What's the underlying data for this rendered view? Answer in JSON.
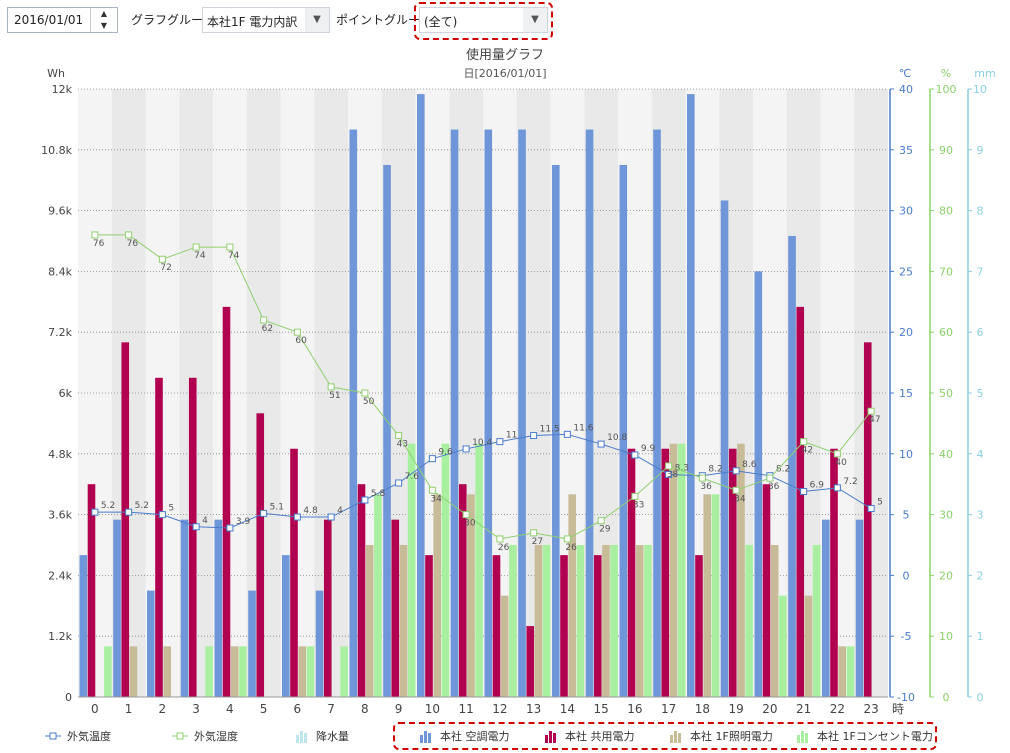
{
  "toolbar": {
    "date_value": "2016/01/01",
    "graph_group_label": "グラフグループ:",
    "graph_group_value": "本社1F 電力内訳",
    "point_group_label": "ポイントグループ:",
    "point_group_value": "(全て)"
  },
  "chart_data": {
    "type": "bar",
    "title": "使用量グラフ",
    "subtitle": "日[2016/01/01]",
    "categories": [
      "0",
      "1",
      "2",
      "3",
      "4",
      "5",
      "6",
      "7",
      "8",
      "9",
      "10",
      "11",
      "12",
      "13",
      "14",
      "15",
      "16",
      "17",
      "18",
      "19",
      "20",
      "21",
      "22",
      "23"
    ],
    "x_unit": "時",
    "y_left": {
      "unit": "Wh",
      "ticks": [
        "0",
        "1.2k",
        "2.4k",
        "3.6k",
        "4.8k",
        "6k",
        "7.2k",
        "8.4k",
        "9.6k",
        "10.8k",
        "12k"
      ],
      "ylim": [
        0,
        12000
      ]
    },
    "y_temp": {
      "unit": "℃",
      "ticks": [
        "-10",
        "-5",
        "0",
        "5",
        "10",
        "15",
        "20",
        "25",
        "30",
        "35",
        "40"
      ],
      "ylim": [
        -10,
        40
      ]
    },
    "y_humidity": {
      "unit": "%",
      "ticks": [
        "0",
        "10",
        "20",
        "30",
        "40",
        "50",
        "60",
        "70",
        "80",
        "90",
        "100"
      ],
      "ylim": [
        0,
        100
      ]
    },
    "y_rain": {
      "unit": "mm",
      "ticks": [
        "0",
        "1",
        "2",
        "3",
        "4",
        "5",
        "6",
        "7",
        "8",
        "9",
        "10"
      ],
      "ylim": [
        0,
        10
      ]
    },
    "bar_series": [
      {
        "name": "本社 空調電力",
        "color": "#6f96d8",
        "values": [
          2800,
          3500,
          2100,
          3500,
          3500,
          2100,
          2800,
          2100,
          11200,
          10500,
          11900,
          11200,
          11200,
          11200,
          10500,
          11200,
          10500,
          11200,
          11900,
          9800,
          8400,
          9100,
          3500,
          3500
        ]
      },
      {
        "name": "本社 共用電力",
        "color": "#b0004f",
        "values": [
          4200,
          7000,
          6300,
          6300,
          7700,
          5600,
          4900,
          3500,
          4200,
          3500,
          2800,
          4200,
          2800,
          1400,
          2800,
          2800,
          4900,
          4900,
          2800,
          4900,
          4200,
          7700,
          4900,
          7000
        ]
      },
      {
        "name": "本社 1F照明電力",
        "color": "#c8bb98",
        "values": [
          0,
          1000,
          1000,
          0,
          1000,
          0,
          1000,
          0,
          3000,
          3000,
          4000,
          4000,
          2000,
          3000,
          4000,
          3000,
          3000,
          5000,
          4000,
          5000,
          3000,
          2000,
          1000,
          0
        ]
      },
      {
        "name": "本社 1Fコンセント電力",
        "color": "#a8f0a0",
        "values": [
          1000,
          0,
          0,
          1000,
          1000,
          0,
          1000,
          1000,
          4000,
          5000,
          5000,
          5000,
          3000,
          3000,
          3000,
          3000,
          3000,
          5000,
          4000,
          3000,
          2000,
          3000,
          1000,
          0
        ]
      }
    ],
    "line_series": [
      {
        "name": "外気温度",
        "axis": "y_temp",
        "color": "#4a7ccc",
        "values": [
          5.2,
          5.2,
          5,
          4,
          3.9,
          5.1,
          4.8,
          4.8,
          6.2,
          7.6,
          9.6,
          10.4,
          11,
          11.5,
          11.6,
          10.8,
          9.9,
          8.3,
          8.2,
          8.6,
          8.2,
          6.9,
          7.2,
          5.5
        ],
        "labels": [
          "5.2",
          "5.2",
          "5",
          "4",
          "3.9",
          "5.1",
          "4.8",
          "4",
          "5.8",
          "7.6",
          "9.6",
          "10.4",
          "11",
          "11.5",
          "11.6",
          "10.8",
          "9.9",
          "8.3",
          "8.2",
          "8.6",
          "8.2",
          "6.9",
          "7.2",
          "5"
        ]
      },
      {
        "name": "外気湿度",
        "axis": "y_humidity",
        "color": "#90d070",
        "values": [
          76,
          76,
          72,
          74,
          74,
          62,
          60,
          51,
          50,
          43,
          34,
          30,
          26,
          27,
          26,
          29,
          33,
          38,
          36,
          34,
          36,
          42,
          40,
          47
        ],
        "labels": [
          "76",
          "76",
          "72",
          "74",
          "74",
          "62",
          "60",
          "51",
          "50",
          "43",
          "34",
          "30",
          "26",
          "27",
          "26",
          "29",
          "33",
          "38",
          "36",
          "34",
          "36",
          "42",
          "40",
          "47"
        ]
      }
    ],
    "rain_series": {
      "name": "降水量",
      "axis": "y_rain",
      "color": "#bfe6ef",
      "values": []
    },
    "legend": [
      {
        "name": "外気温度",
        "icon": "line-square-blue"
      },
      {
        "name": "外気湿度",
        "icon": "line-square-green"
      },
      {
        "name": "降水量",
        "icon": "bar-lightblue"
      },
      {
        "name": "本社 空調電力",
        "icon": "bar-blue"
      },
      {
        "name": "本社 共用電力",
        "icon": "bar-crimson"
      },
      {
        "name": "本社 1F照明電力",
        "icon": "bar-tan"
      },
      {
        "name": "本社 1Fコンセント電力",
        "icon": "bar-lightgreen"
      }
    ]
  }
}
